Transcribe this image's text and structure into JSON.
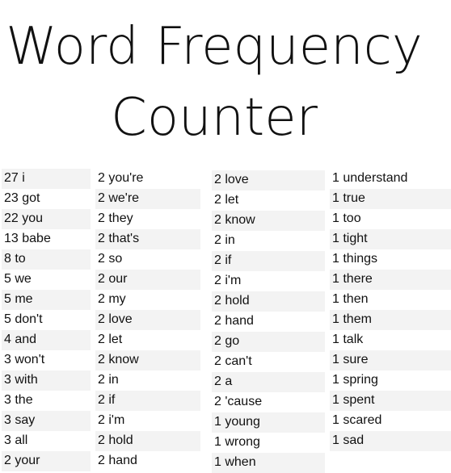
{
  "title": {
    "line1": "Word Frequency",
    "line2": "Counter"
  },
  "colors": {
    "stripe": "#f3f3f3",
    "text": "#111111",
    "background": "#ffffff"
  },
  "columns": [
    [
      "27 i",
      "23 got",
      "22 you",
      "13 babe",
      "8 to",
      "5 we",
      "5 me",
      "5 don't",
      "4 and",
      "3 won't",
      "3 with",
      "3 the",
      "3 say",
      "3 all",
      "2 your"
    ],
    [
      "2 you're",
      "2 we're",
      "2 they",
      "2 that's",
      "2 so",
      "2 our",
      "2 my",
      "2 love",
      "2 let",
      "2 know",
      "2 in",
      "2 if",
      "2 i'm",
      "2 hold",
      "2 hand"
    ],
    [
      "2 love",
      "2 let",
      "2 know",
      "2 in",
      "2 if",
      "2 i'm",
      "2 hold",
      "2 hand",
      "2 go",
      "2 can't",
      "2 a",
      "2 'cause",
      "1 young",
      "1 wrong",
      "1 when"
    ],
    [
      "1 understand",
      "1 true",
      "1 too",
      "1 tight",
      "1 things",
      "1 there",
      "1 then",
      "1 them",
      "1 talk",
      "1 sure",
      "1 spring",
      "1 spent",
      "1 scared",
      "1 sad"
    ]
  ]
}
